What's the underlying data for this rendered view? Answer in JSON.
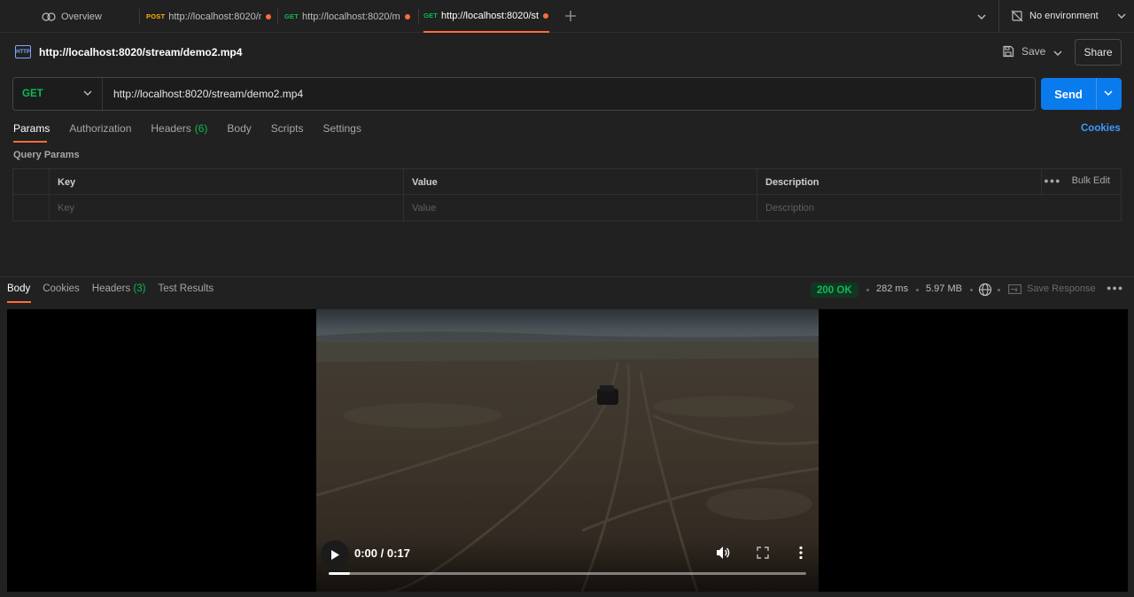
{
  "tabs": {
    "overview": "Overview",
    "items": [
      {
        "method": "POST",
        "url": "http://localhost:8020/r",
        "method_color": "#ffb400",
        "active": false,
        "unsaved": true
      },
      {
        "method": "GET",
        "url": "http://localhost:8020/m",
        "method_color": "#0cbb52",
        "active": false,
        "unsaved": true
      },
      {
        "method": "GET",
        "url": "http://localhost:8020/st",
        "method_color": "#0cbb52",
        "active": true,
        "unsaved": true
      }
    ],
    "environment": "No environment"
  },
  "request": {
    "icon_text": "HTTP",
    "title": "http://localhost:8020/stream/demo2.mp4",
    "save_label": "Save",
    "share_label": "Share",
    "method": "GET",
    "url": "http://localhost:8020/stream/demo2.mp4",
    "send_label": "Send"
  },
  "request_tabs": {
    "params": "Params",
    "authorization": "Authorization",
    "headers": "Headers",
    "headers_count": "(6)",
    "body": "Body",
    "scripts": "Scripts",
    "settings": "Settings",
    "cookies": "Cookies"
  },
  "query_params": {
    "title": "Query Params",
    "columns": [
      "Key",
      "Value",
      "Description"
    ],
    "placeholders": [
      "Key",
      "Value",
      "Description"
    ],
    "bulk_edit": "Bulk Edit"
  },
  "response": {
    "tabs": {
      "body": "Body",
      "cookies": "Cookies",
      "headers": "Headers",
      "headers_count": "(3)",
      "test_results": "Test Results"
    },
    "status": "200 OK",
    "time": "282 ms",
    "size": "5.97 MB",
    "save_response": "Save Response",
    "status_color": "#0cbb52"
  },
  "video": {
    "time": "0:00 / 0:17",
    "buffered_fraction": 0.045
  },
  "colors": {
    "accent": "#ff6c37",
    "send": "#097bed",
    "link": "#3d9aff"
  }
}
